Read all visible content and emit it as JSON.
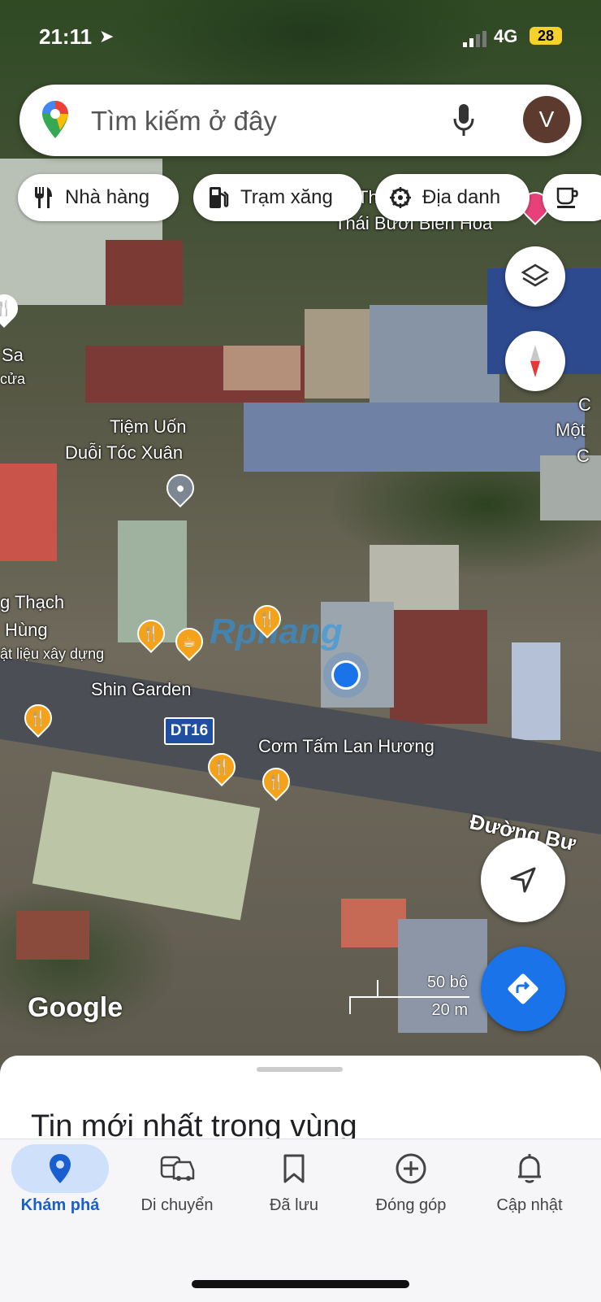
{
  "status_bar": {
    "time": "21:11",
    "network": "4G",
    "battery": "28"
  },
  "search": {
    "placeholder": "Tìm kiếm ở đây",
    "avatar_letter": "V"
  },
  "chips": [
    {
      "label": "Nhà hàng",
      "icon": "restaurant-icon"
    },
    {
      "label": "Trạm xăng",
      "icon": "gas-station-icon"
    },
    {
      "label": "Địa danh",
      "icon": "landmark-icon"
    },
    {
      "label": "",
      "icon": "coffee-icon"
    }
  ],
  "map": {
    "labels": {
      "thai_buoi_1": "Th",
      "thai_buoi_2": "Thái Bưởi Biên Hoà",
      "sa": "Sa",
      "sa_sub": "cửa",
      "tiem1": "Tiệm Uốn",
      "tiem2": "Duỗi Tóc Xuân",
      "thach1": "g Thạch",
      "thach2": "Hùng",
      "thach3": "ật liệu xây dựng",
      "shin": "Shin Garden",
      "road_shield": "DT16",
      "com_tam": "Cơm Tấm Lan Hương",
      "duong": "Đường Bư",
      "right1": "C",
      "right2": "Một",
      "right3": "C",
      "watermark": "Rphang",
      "google": "Google",
      "scale_ft": "50 bộ",
      "scale_m": "20 m"
    }
  },
  "sheet": {
    "title": "Tin mới nhất trong vùng"
  },
  "nav": [
    {
      "label": "Khám phá",
      "icon": "explore-pin-icon",
      "active": true
    },
    {
      "label": "Di chuyển",
      "icon": "commute-icon",
      "active": false
    },
    {
      "label": "Đã lưu",
      "icon": "bookmark-icon",
      "active": false
    },
    {
      "label": "Đóng góp",
      "icon": "add-circle-icon",
      "active": false
    },
    {
      "label": "Cập nhật",
      "icon": "bell-icon",
      "active": false
    }
  ],
  "colors": {
    "accent": "#1a73e8",
    "active_nav_bg": "#cfe0fb",
    "poi_orange": "#f4a21a"
  }
}
